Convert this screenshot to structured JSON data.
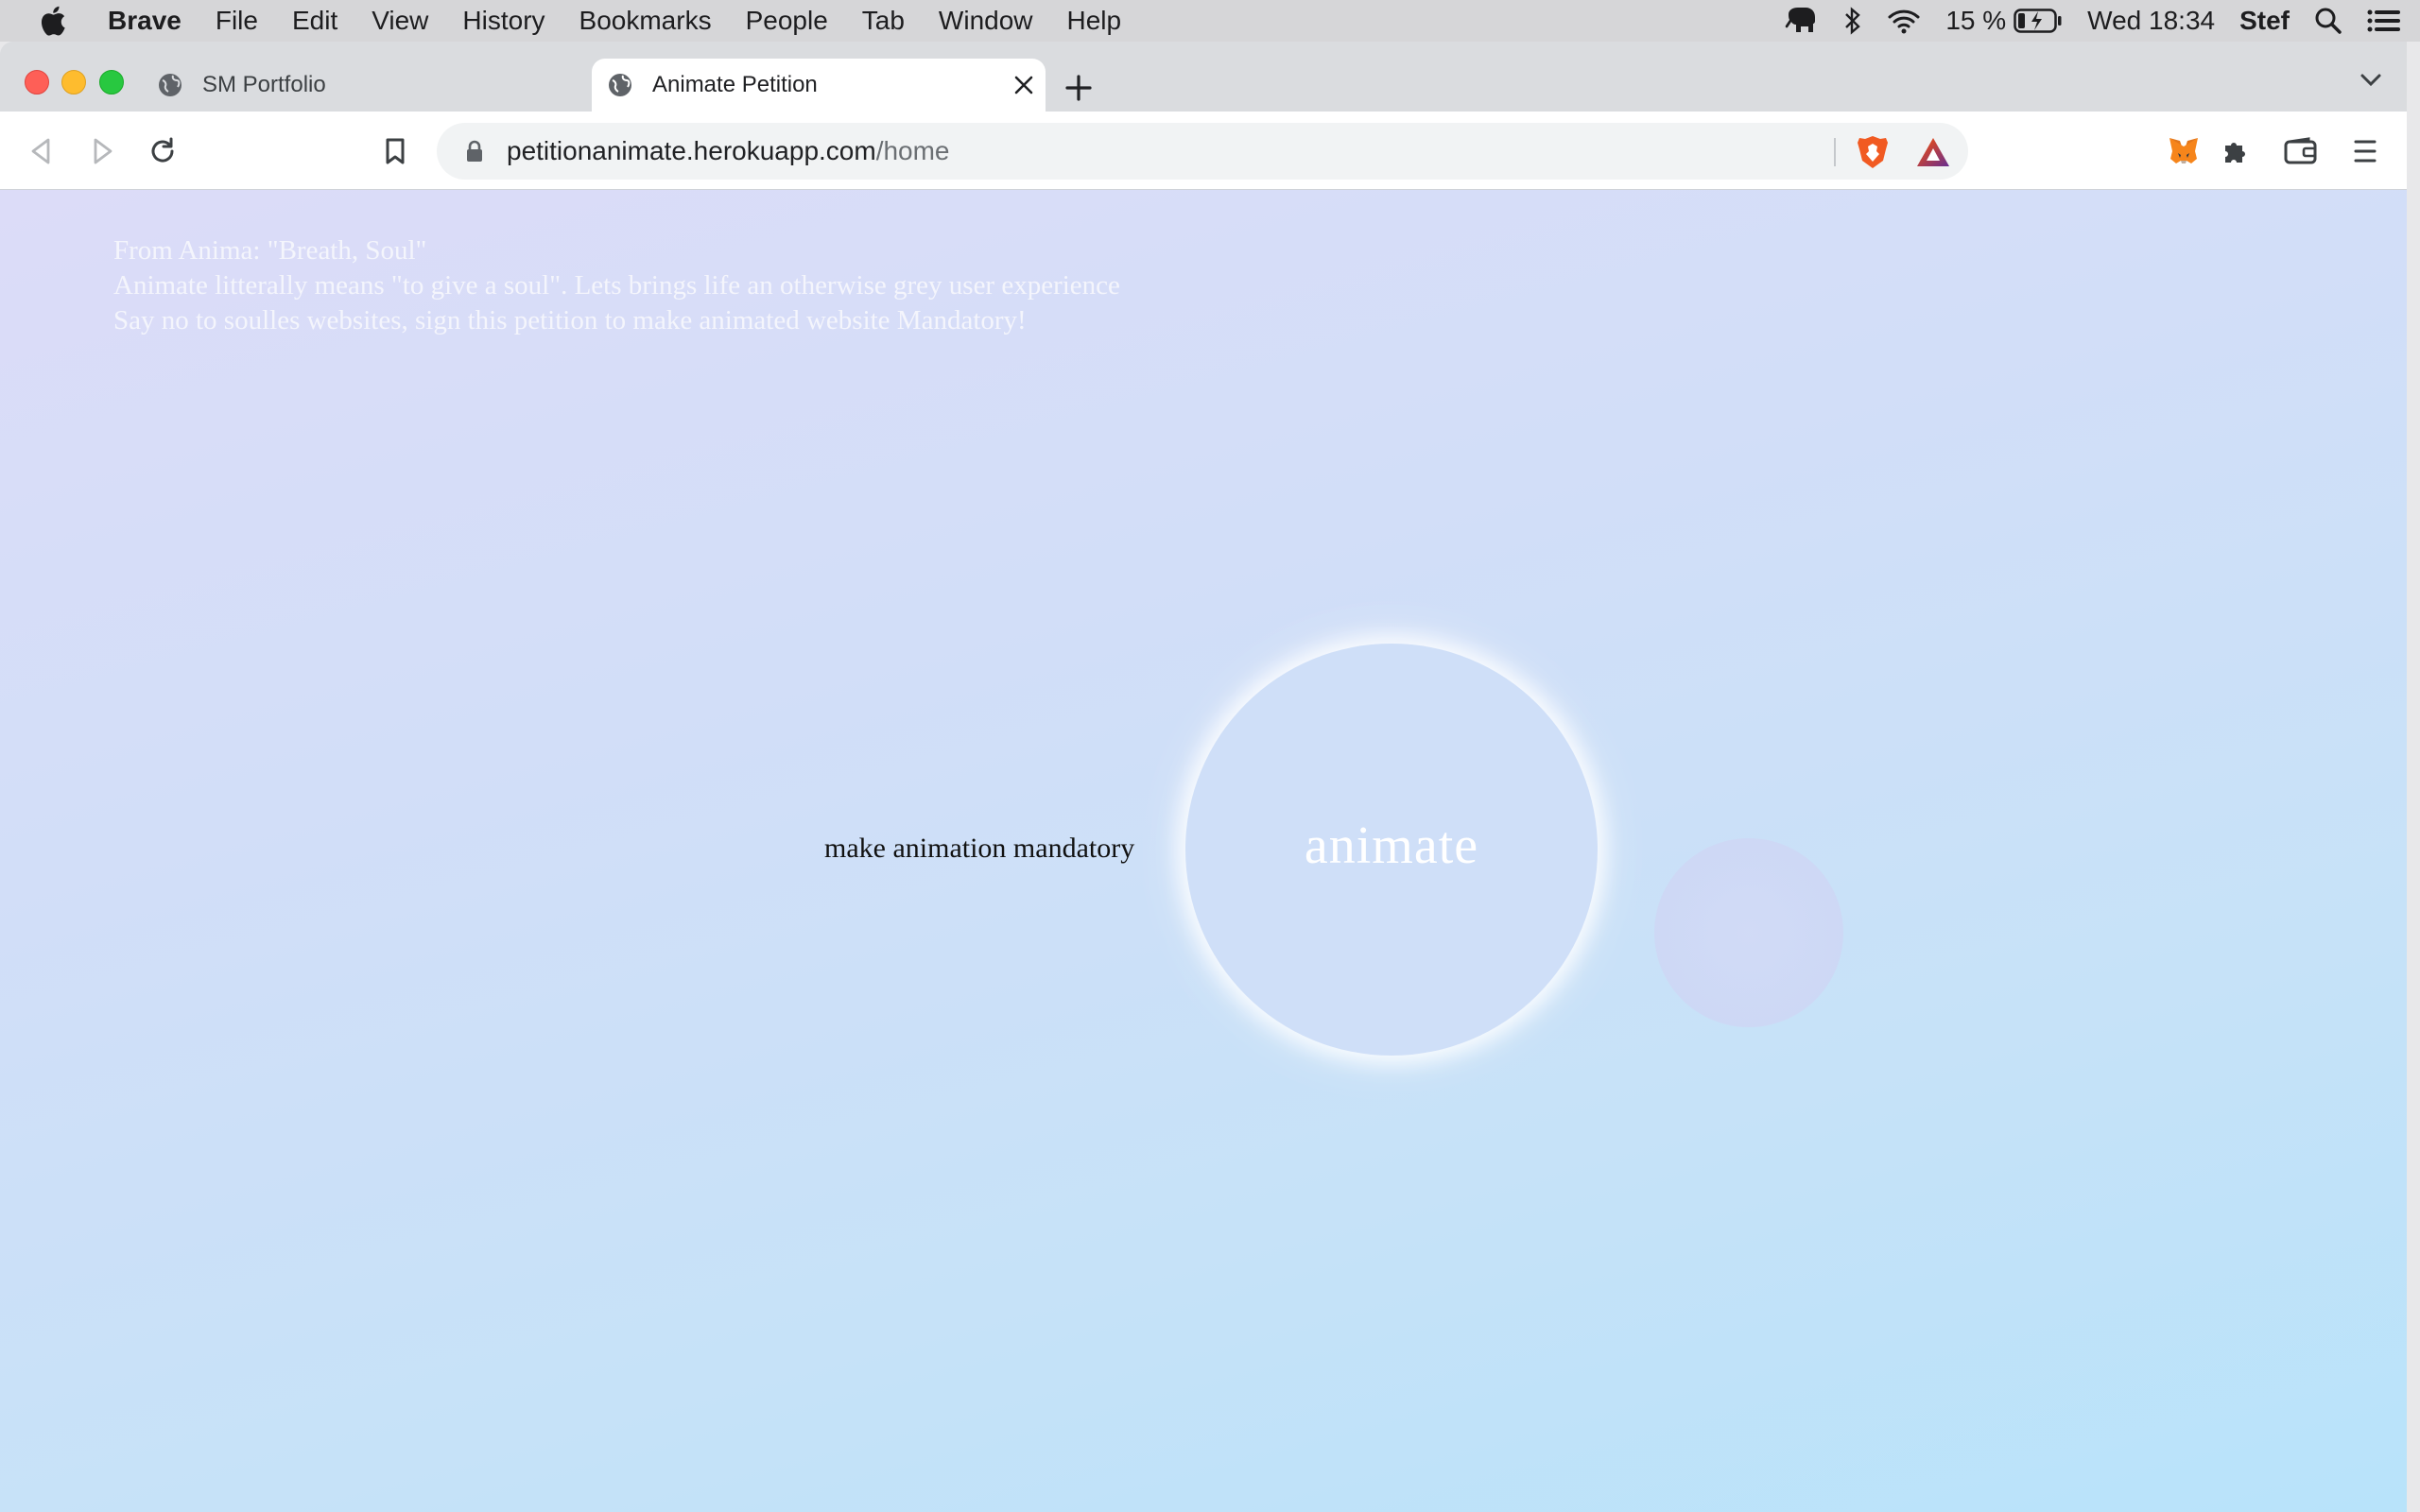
{
  "menubar": {
    "app_name": "Brave",
    "items": [
      "File",
      "Edit",
      "View",
      "History",
      "Bookmarks",
      "People",
      "Tab",
      "Window",
      "Help"
    ],
    "battery": "15 %",
    "clock": "Wed 18:34",
    "user": "Stef"
  },
  "tabs": [
    {
      "title": "SM Portfolio",
      "active": false
    },
    {
      "title": "Animate Petition",
      "active": true
    }
  ],
  "toolbar": {
    "url_host": "petitionanimate.herokuapp.com",
    "url_path": "/home"
  },
  "page": {
    "intro_lines": [
      "From Anima: \"Breath, Soul\"",
      "Animate litterally means \"to give a soul\". Lets brings life an otherwise grey user experience",
      "Say no to soulles websites, sign this petition to make animated website Mandatory!"
    ],
    "cta_label": "make animation mandatory",
    "circle_label": "animate"
  },
  "colors": {
    "gradient_top": "#dcdcf8",
    "gradient_bottom": "#b8e3fa",
    "circle": "#cfdff8",
    "intro_text": "#f4f5fc"
  }
}
